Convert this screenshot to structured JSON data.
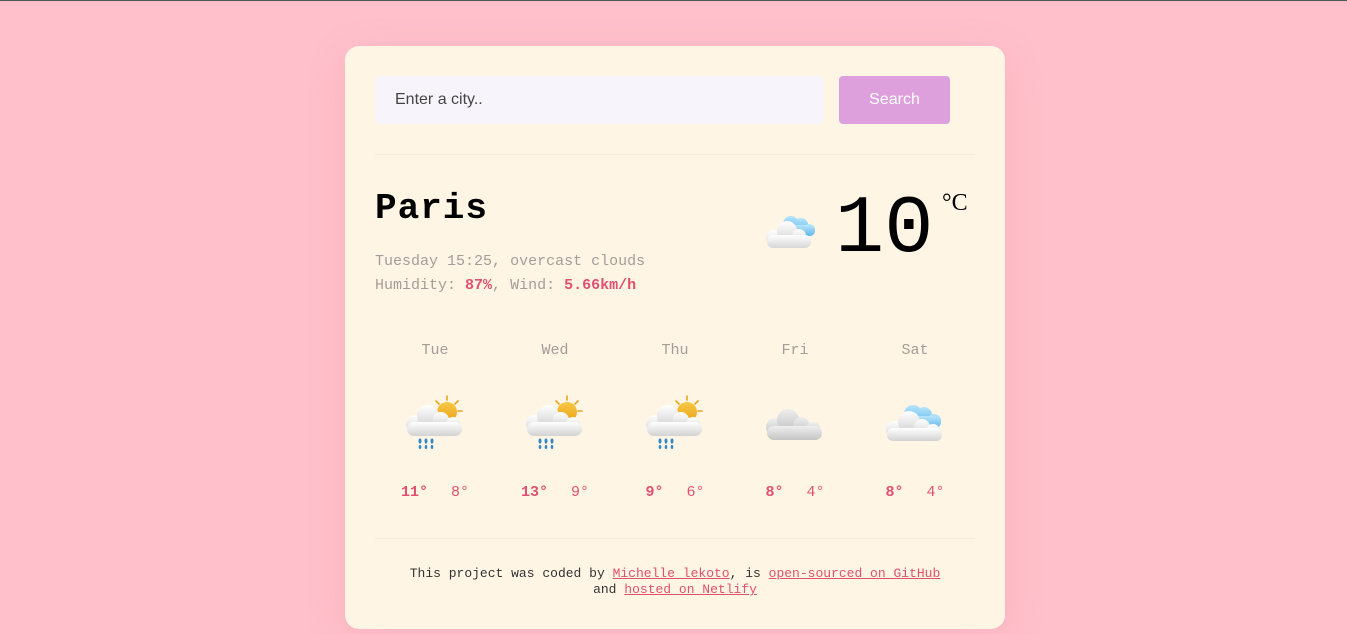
{
  "search": {
    "placeholder": "Enter a city..",
    "button_label": "Search"
  },
  "current": {
    "city": "Paris",
    "day": "Tuesday",
    "time": "15:25",
    "description": "overcast clouds",
    "humidity_label": "Humidity:",
    "humidity": "87%",
    "wind_label": "Wind:",
    "wind": "5.66km/h",
    "icon": "few-clouds-icon",
    "temperature": "10",
    "unit": "°C"
  },
  "forecast": [
    {
      "day": "Tue",
      "icon": "sun-rain-icon",
      "max": "11°",
      "min": "8°"
    },
    {
      "day": "Wed",
      "icon": "sun-rain-icon",
      "max": "13°",
      "min": "9°"
    },
    {
      "day": "Thu",
      "icon": "sun-rain-icon",
      "max": "9°",
      "min": "6°"
    },
    {
      "day": "Fri",
      "icon": "cloud-icon",
      "max": "8°",
      "min": "4°"
    },
    {
      "day": "Sat",
      "icon": "few-clouds-icon",
      "max": "8°",
      "min": "4°"
    }
  ],
  "footer": {
    "text_1": "This project was coded by",
    "author_link": "Michelle lekoto",
    "text_2": ", is",
    "github_link": "open-sourced on GitHub",
    "text_3": "and",
    "netlify_link": "hosted on Netlify"
  },
  "colors": {
    "background": "#ffc0cb",
    "card": "#fff5e4",
    "accent": "#e0516f",
    "button": "#dda0dd"
  }
}
